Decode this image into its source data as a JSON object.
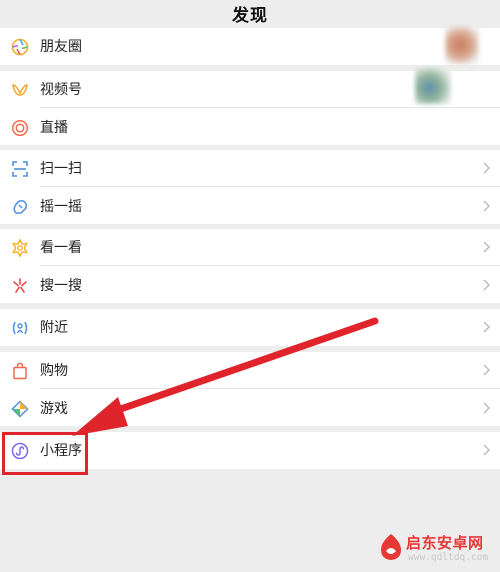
{
  "header": {
    "title": "发现"
  },
  "items": {
    "moments": "朋友圈",
    "channels": "视频号",
    "live": "直播",
    "scan": "扫一扫",
    "shake": "摇一摇",
    "top_stories": "看一看",
    "search": "搜一搜",
    "nearby": "附近",
    "shopping": "购物",
    "games": "游戏",
    "mini_programs": "小程序"
  },
  "chevron_icon": "chevron-right-icon",
  "colors": {
    "background": "#ededed",
    "row_background": "#ffffff",
    "annotation_red": "#e0242b",
    "text": "#222222"
  },
  "watermark": {
    "brand": "启东安卓网",
    "url": "www.qdltdq.com"
  }
}
